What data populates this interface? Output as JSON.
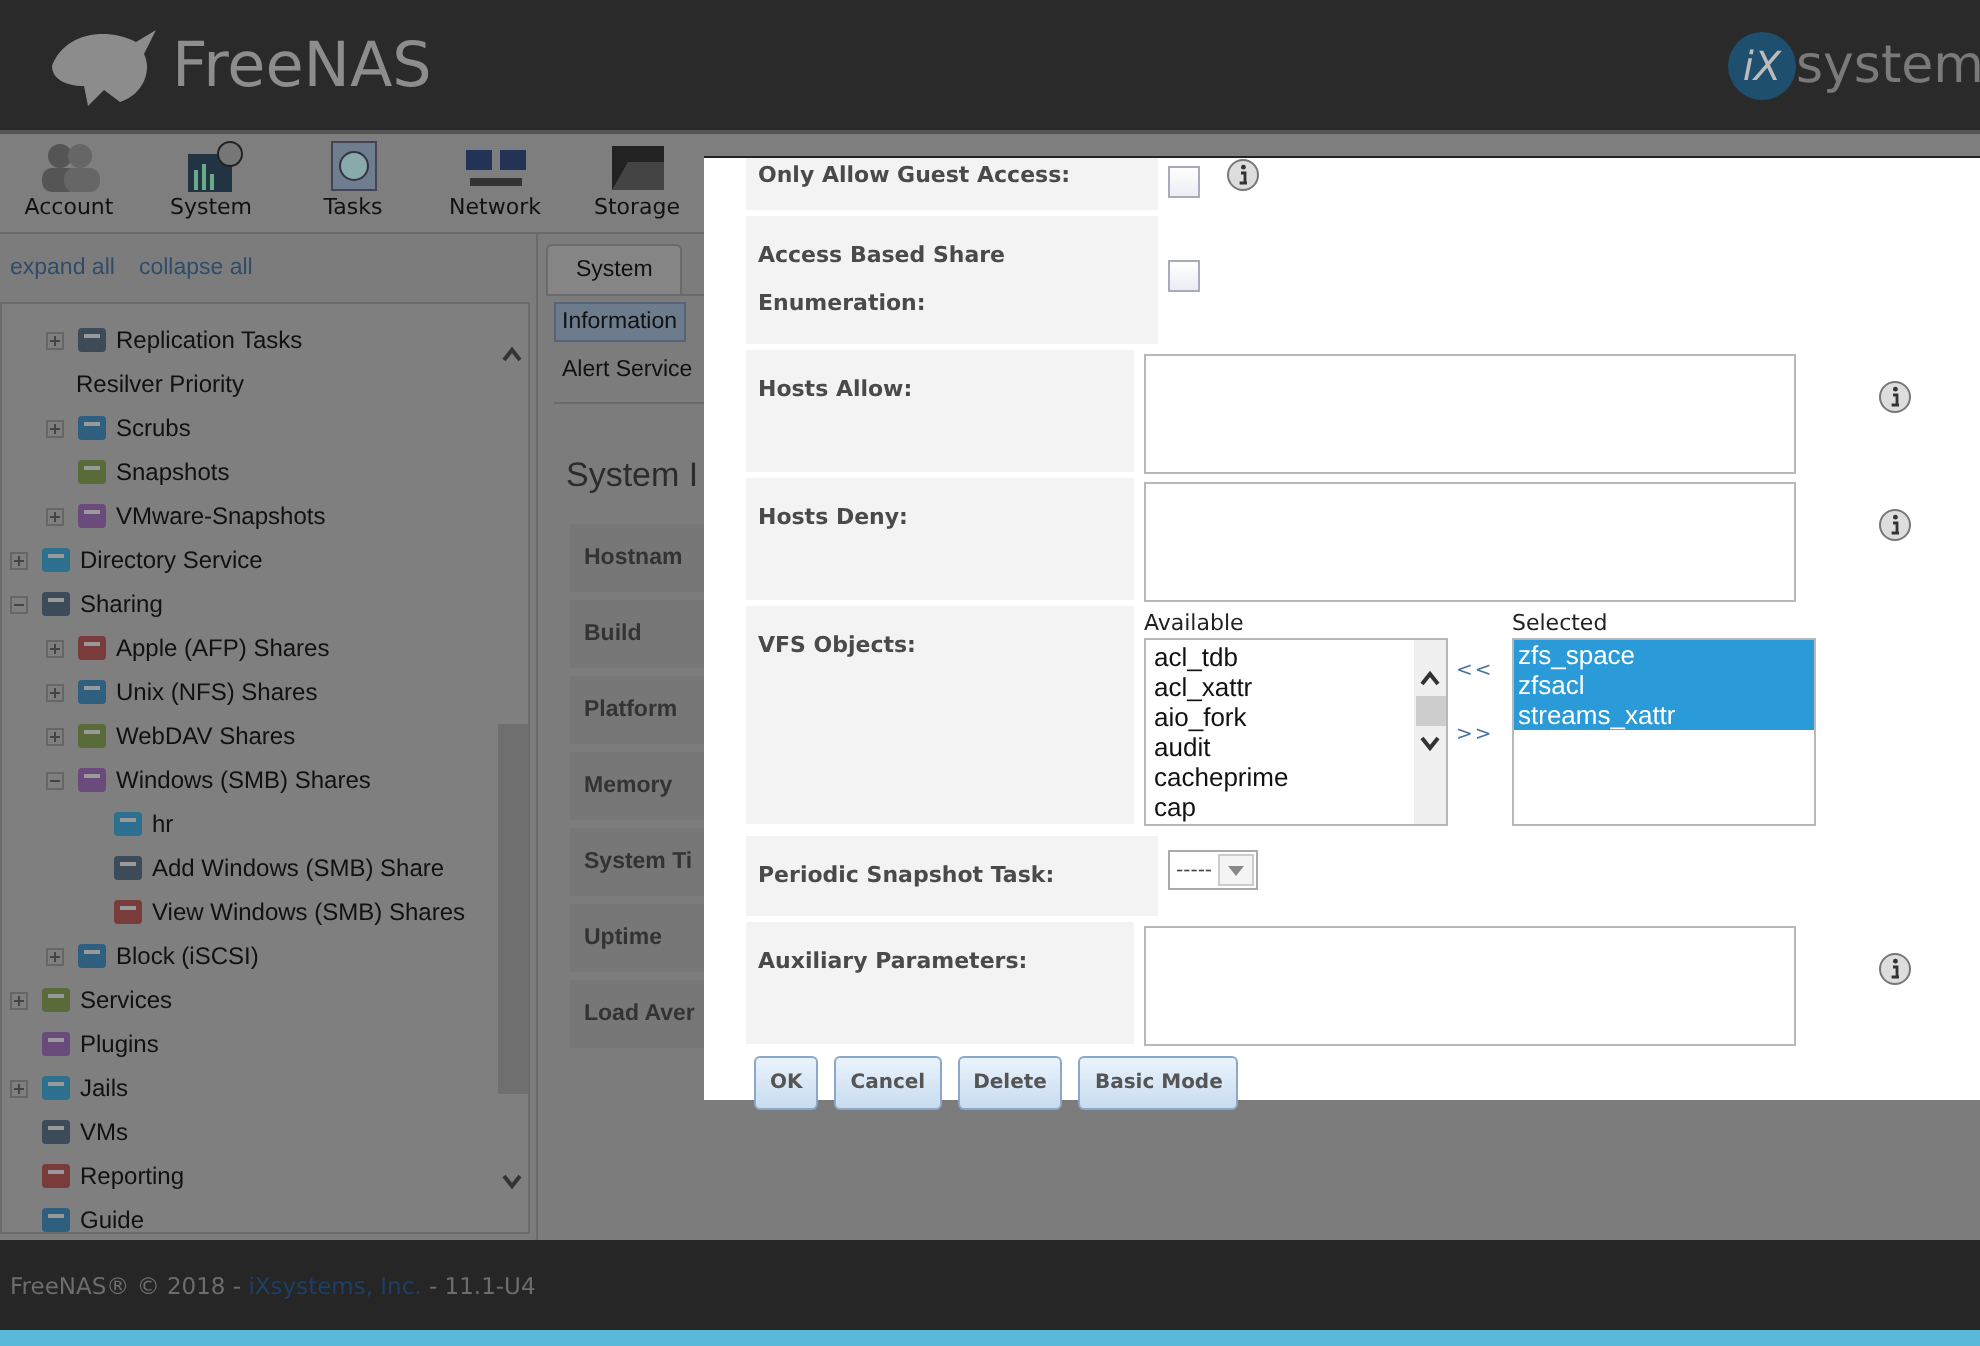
{
  "header": {
    "logo": "FreeNAS",
    "brand_mark": "iX",
    "brand": "system"
  },
  "toolbar": [
    {
      "label": "Account"
    },
    {
      "label": "System"
    },
    {
      "label": "Tasks"
    },
    {
      "label": "Network"
    },
    {
      "label": "Storage"
    }
  ],
  "sidebar": {
    "links": [
      "expand all",
      "collapse all"
    ],
    "continued": [
      {
        "label": "Replication Tasks",
        "icon": true,
        "expandable": true,
        "expanded": false
      },
      {
        "label": "Resilver Priority",
        "icon": false,
        "expandable": false
      },
      {
        "label": "Scrubs",
        "icon": true,
        "expandable": true,
        "expanded": false
      },
      {
        "label": "Snapshots",
        "icon": true,
        "expandable": false
      },
      {
        "label": "VMware-Snapshots",
        "icon": true,
        "expandable": true,
        "expanded": false
      }
    ],
    "items": [
      {
        "label": "Directory Service",
        "icon": true,
        "expandable": true,
        "expanded": false
      },
      {
        "label": "Sharing",
        "icon": true,
        "expandable": true,
        "expanded": true,
        "children": [
          {
            "label": "Apple (AFP) Shares",
            "icon": true,
            "expandable": true,
            "expanded": false
          },
          {
            "label": "Unix (NFS) Shares",
            "icon": true,
            "expandable": true,
            "expanded": false
          },
          {
            "label": "WebDAV Shares",
            "icon": true,
            "expandable": true,
            "expanded": false
          },
          {
            "label": "Windows (SMB) Shares",
            "icon": true,
            "expandable": true,
            "expanded": true,
            "children": [
              {
                "label": "hr",
                "icon": true,
                "expandable": false
              },
              {
                "label": "Add Windows (SMB) Share",
                "icon": true,
                "expandable": false
              },
              {
                "label": "View Windows (SMB) Shares",
                "icon": true,
                "expandable": false
              }
            ]
          },
          {
            "label": "Block (iSCSI)",
            "icon": true,
            "expandable": true,
            "expanded": false
          }
        ]
      },
      {
        "label": "Services",
        "icon": true,
        "expandable": true,
        "expanded": false
      },
      {
        "label": "Plugins",
        "icon": true,
        "expandable": false
      },
      {
        "label": "Jails",
        "icon": true,
        "expandable": true,
        "expanded": false
      },
      {
        "label": "VMs",
        "icon": true,
        "expandable": false
      },
      {
        "label": "Reporting",
        "icon": true,
        "expandable": false
      },
      {
        "label": "Guide",
        "icon": true,
        "expandable": false
      }
    ]
  },
  "tabs": [
    {
      "label": "System",
      "selected": true
    }
  ],
  "subtabs": [
    {
      "label": "Information",
      "selected": true
    },
    {
      "label": "Alert Service",
      "selected": false
    }
  ],
  "panel": {
    "title": "System I",
    "rows": [
      "Hostnam",
      "Build",
      "Platform",
      "Memory",
      "System Ti",
      "Uptime",
      "Load Aver"
    ]
  },
  "dialog": {
    "fields": [
      {
        "kind": "checkbox",
        "label": "Only Allow Guest Access:",
        "checked": false,
        "info": true
      },
      {
        "kind": "checkbox",
        "label": "Access Based Share Enumeration:",
        "checked": false,
        "info": false
      },
      {
        "kind": "textarea",
        "label": "Hosts Allow:",
        "info": true
      },
      {
        "kind": "textarea",
        "label": "Hosts Deny:",
        "info": true
      },
      {
        "kind": "dual_list",
        "label": "VFS Objects:",
        "available_label": "Available",
        "selected_label": "Selected",
        "remove": "<<",
        "add": ">>",
        "available": [
          "acl_tdb",
          "acl_xattr",
          "aio_fork",
          "audit",
          "cacheprime",
          "cap"
        ],
        "selected_items": [
          {
            "label": "zfs_space",
            "selected": true
          },
          {
            "label": "zfsacl",
            "selected": true
          },
          {
            "label": "streams_xattr",
            "selected": true
          }
        ]
      },
      {
        "kind": "select",
        "label": "Periodic Snapshot Task:",
        "value": "-----"
      },
      {
        "kind": "textarea",
        "label": "Auxiliary Parameters:",
        "info": true
      }
    ],
    "buttons": [
      "OK",
      "Cancel",
      "Delete",
      "Basic Mode"
    ]
  },
  "footer": {
    "before": "FreeNAS® © 2018 - ",
    "link": "iXsystems, Inc.",
    "after": " - 11.1-U4"
  }
}
